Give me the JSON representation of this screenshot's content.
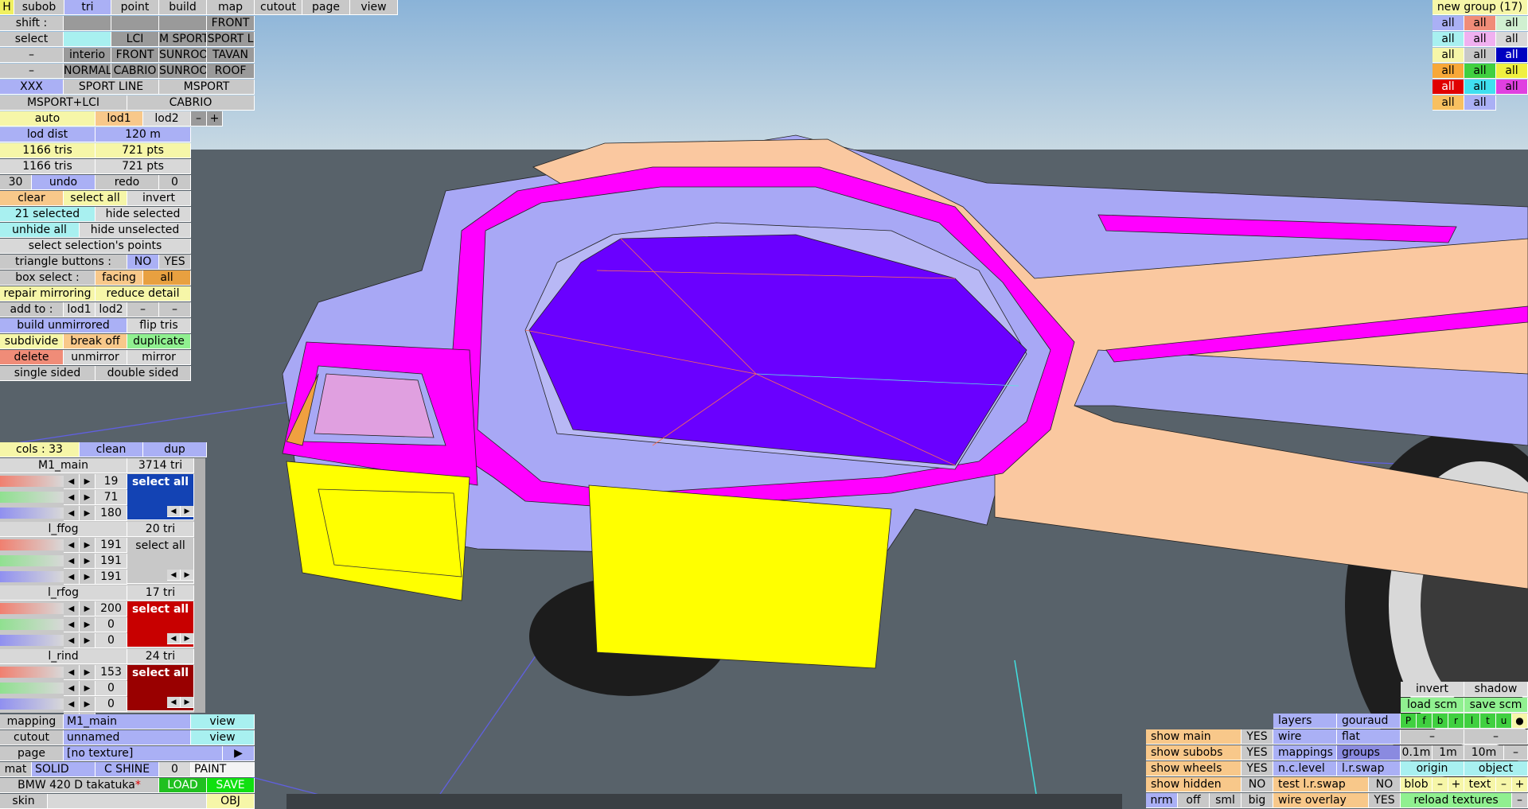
{
  "topbar": {
    "h": "H",
    "tabs": [
      "subob",
      "tri",
      "point",
      "build",
      "map",
      "cutout",
      "page",
      "view"
    ],
    "active_tab": "tri"
  },
  "filters": {
    "shift_label": "shift :",
    "select_label": "select",
    "front": "FRONT",
    "r3": [
      "interio",
      "LCI",
      "M SPORT",
      "SPORT L"
    ],
    "r4": [
      "interio",
      "FRONT",
      "SUNROOF",
      "TAVAN"
    ],
    "r5": [
      "NORMALL",
      "CABRIO",
      "SUNROOF",
      "ROOF"
    ],
    "r6": [
      "XXX",
      "SPORT LINE",
      "MSPORT"
    ],
    "r7": [
      "MSPORT+LCI",
      "CABRIO"
    ],
    "dash": "–"
  },
  "lod": {
    "auto": "auto",
    "lod1": "lod1",
    "lod2": "lod2",
    "minus": "–",
    "plus": "+",
    "dist_label": "lod dist",
    "dist_value": "120 m",
    "tris1": "1166 tris",
    "pts1": "721 pts",
    "tris2": "1166 tris",
    "pts2": "721 pts"
  },
  "edit": {
    "undo_count": "30",
    "undo": "undo",
    "redo": "redo",
    "redo_count": "0",
    "clear": "clear",
    "select_all": "select all",
    "invert": "invert",
    "selected": "21 selected",
    "hide_selected": "hide selected",
    "unhide_all": "unhide all",
    "hide_unselected": "hide unselected",
    "select_points": "select selection's points",
    "tri_buttons": "triangle buttons :",
    "no": "NO",
    "yes": "YES",
    "box_select": "box select :",
    "facing": "facing",
    "all": "all",
    "repair": "repair mirroring",
    "reduce": "reduce detail",
    "add_to": "add to :",
    "lod1": "lod1",
    "lod2": "lod2",
    "dash": "–",
    "build_unmirrored": "build unmirrored",
    "flip": "flip tris",
    "subdivide": "subdivide",
    "break_off": "break off",
    "duplicate": "duplicate",
    "delete": "delete",
    "unmirror": "unmirror",
    "mirror": "mirror",
    "single": "single sided",
    "double": "double sided"
  },
  "cols": {
    "count": "cols : 33",
    "clean": "clean",
    "dup": "dup",
    "materials": [
      {
        "name": "M1_main",
        "tri": "3714 tri",
        "rgb": [
          "19",
          "71",
          "180"
        ],
        "swatch": "#1343b4",
        "btn": "select all"
      },
      {
        "name": "l_ffog",
        "tri": "20 tri",
        "rgb": [
          "191",
          "191",
          "191"
        ],
        "swatch": "#c8c8c8",
        "btn": "select all"
      },
      {
        "name": "l_rfog",
        "tri": "17 tri",
        "rgb": [
          "200",
          "0",
          "0"
        ],
        "swatch": "#c80000",
        "btn": "select all"
      },
      {
        "name": "l_rind",
        "tri": "24 tri",
        "rgb": [
          "153",
          "0",
          "0"
        ],
        "swatch": "#990000",
        "btn": "select all"
      }
    ]
  },
  "bottom_left": {
    "mapping": "mapping",
    "mapping_val": "M1_main",
    "view": "view",
    "cutout": "cutout",
    "cutout_val": "unnamed",
    "page": "page",
    "page_val": "[no texture]",
    "arrow": "▶",
    "mat": "mat",
    "solid": "SOLID",
    "cshine": "C SHINE",
    "zero": "0",
    "paint": "PAINT",
    "file": "BMW 420 D takatuka",
    "star": "*",
    "load": "LOAD",
    "save": "SAVE",
    "skin": "skin",
    "obj": "OBJ"
  },
  "groups": {
    "title": "new group (17)",
    "all": "all"
  },
  "right_panel": {
    "invert": "invert",
    "shadow": "shadow",
    "load_scm": "load scm",
    "save_scm": "save scm",
    "letters": [
      "P",
      "f",
      "b",
      "r",
      "l",
      "t",
      "u",
      "●"
    ],
    "dash": "–",
    "d1": "0.1m",
    "d2": "1m",
    "d3": "10m",
    "origin": "origin",
    "object": "object",
    "blob": "blob",
    "text": "text",
    "plus": "+",
    "reload": "reload textures"
  },
  "bottom_right": {
    "show_main": "show main",
    "show_subobs": "show subobs",
    "show_wheels": "show wheels",
    "show_hidden": "show hidden",
    "yes": "YES",
    "no": "NO",
    "layers": "layers",
    "gouraud": "gouraud",
    "wire": "wire",
    "flat": "flat",
    "mappings": "mappings",
    "groups": "groups",
    "nc_level": "n.c.level",
    "lr_swap": "l.r.swap",
    "test_lr": "test l.r.swap",
    "wire_overlay": "wire overlay",
    "nrm": "nrm",
    "off": "off",
    "sml": "sml",
    "big": "big"
  }
}
